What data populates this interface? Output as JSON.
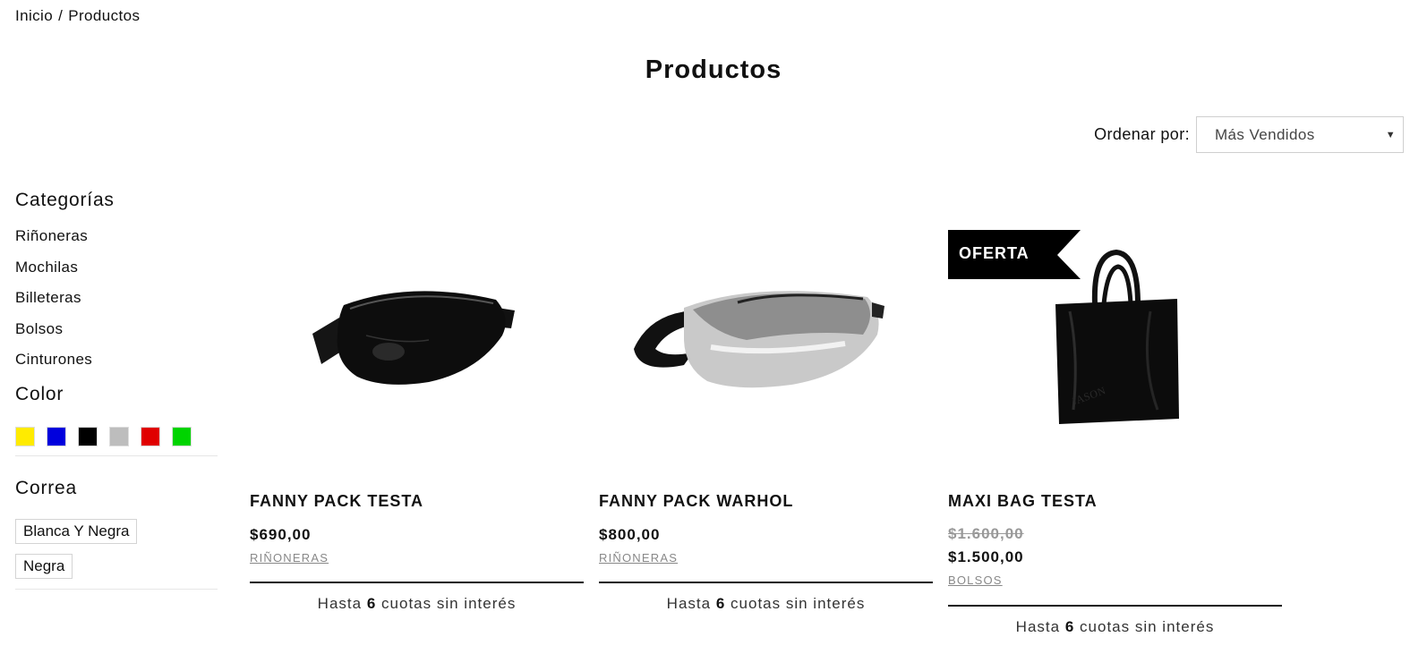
{
  "breadcrumb": {
    "home": "Inicio",
    "separator": "/",
    "current": "Productos"
  },
  "page": {
    "title": "Productos"
  },
  "sort": {
    "label": "Ordenar por:",
    "selected": "Más Vendidos"
  },
  "filters": {
    "categories_title": "Categorías",
    "categories": [
      "Riñoneras",
      "Mochilas",
      "Billeteras",
      "Bolsos",
      "Cinturones"
    ],
    "color_title": "Color",
    "colors": [
      "#ffeb00",
      "#0000dd",
      "#000000",
      "#bdbdbd",
      "#e00000",
      "#00d400"
    ],
    "strap_title": "Correa",
    "straps": [
      "Blanca Y Negra",
      "Negra"
    ]
  },
  "products": [
    {
      "name": "FANNY PACK TESTA",
      "price": "$690,00",
      "category": "RIÑONERAS",
      "installments_prefix": "Hasta",
      "installments_count": "6",
      "installments_suffix": "cuotas sin interés"
    },
    {
      "name": "FANNY PACK WARHOL",
      "price": "$800,00",
      "category": "RIÑONERAS",
      "installments_prefix": "Hasta",
      "installments_count": "6",
      "installments_suffix": "cuotas sin interés"
    },
    {
      "name": "MAXI BAG TESTA",
      "badge": "OFERTA",
      "old_price": "$1.600,00",
      "price": "$1.500,00",
      "category": "BOLSOS",
      "installments_prefix": "Hasta",
      "installments_count": "6",
      "installments_suffix": "cuotas sin interés"
    }
  ]
}
